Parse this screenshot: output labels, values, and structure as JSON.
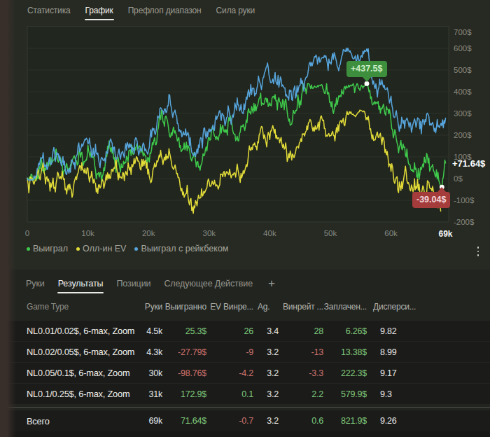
{
  "top_tabs": {
    "items": [
      {
        "label": "Статистика",
        "active": false
      },
      {
        "label": "График",
        "active": true
      },
      {
        "label": "Префлоп диапазон",
        "active": false
      },
      {
        "label": "Сила руки",
        "active": false
      }
    ]
  },
  "chart_data": {
    "type": "line",
    "title": "",
    "xlabel": "",
    "ylabel": "",
    "x_axis": {
      "ticks": [
        0,
        10,
        20,
        30,
        40,
        50,
        60,
        69
      ],
      "tick_labels": [
        "0",
        "10k",
        "20k",
        "30k",
        "40k",
        "50k",
        "60k",
        "69k"
      ],
      "range_k": [
        0,
        69.5
      ]
    },
    "y_axis": {
      "ticks": [
        700,
        600,
        500,
        400,
        300,
        200,
        100,
        0,
        -100,
        -200
      ],
      "tick_labels": [
        "700$",
        "600$",
        "500$",
        "400$",
        "300$",
        "200$",
        "100$",
        "0$",
        "-100$",
        "-200$"
      ],
      "range": [
        -200,
        700
      ]
    },
    "grid": true,
    "legend_position": "bottom-left",
    "series": [
      {
        "name": "Выиграл",
        "color": "#3fca4c",
        "seed": 11,
        "noise_amp": 68,
        "points": [
          [
            0,
            0
          ],
          [
            1,
            -5
          ],
          [
            2,
            45
          ],
          [
            3,
            40
          ],
          [
            4,
            70
          ],
          [
            5,
            90
          ],
          [
            6,
            45
          ],
          [
            7,
            30
          ],
          [
            8,
            80
          ],
          [
            9,
            135
          ],
          [
            10,
            140
          ],
          [
            11,
            85
          ],
          [
            12,
            30
          ],
          [
            13,
            85
          ],
          [
            14,
            125
          ],
          [
            15,
            95
          ],
          [
            16,
            70
          ],
          [
            17,
            120
          ],
          [
            18,
            155
          ],
          [
            19,
            125
          ],
          [
            20,
            100
          ],
          [
            21,
            185
          ],
          [
            22,
            285
          ],
          [
            23,
            265
          ],
          [
            24,
            225
          ],
          [
            25,
            175
          ],
          [
            26,
            145
          ],
          [
            27,
            95
          ],
          [
            28,
            70
          ],
          [
            29,
            130
          ],
          [
            30,
            180
          ],
          [
            31,
            200
          ],
          [
            32,
            215
          ],
          [
            33,
            215
          ],
          [
            34,
            210
          ],
          [
            35,
            215
          ],
          [
            36,
            255
          ],
          [
            37,
            325
          ],
          [
            38,
            340
          ],
          [
            39,
            350
          ],
          [
            40,
            350
          ],
          [
            41,
            350
          ],
          [
            42,
            335
          ],
          [
            43,
            285
          ],
          [
            44,
            300
          ],
          [
            45,
            355
          ],
          [
            46,
            390
          ],
          [
            47,
            420
          ],
          [
            48,
            425
          ],
          [
            49,
            395
          ],
          [
            50,
            345
          ],
          [
            51,
            360
          ],
          [
            52,
            400
          ],
          [
            53,
            430
          ],
          [
            54,
            400
          ],
          [
            55,
            420
          ],
          [
            56,
            437.5
          ],
          [
            57,
            340
          ],
          [
            58,
            330
          ],
          [
            59,
            300
          ],
          [
            60,
            265
          ],
          [
            61,
            165
          ],
          [
            62,
            150
          ],
          [
            63,
            70
          ],
          [
            64,
            55
          ],
          [
            65,
            30
          ],
          [
            66,
            95
          ],
          [
            67,
            40
          ],
          [
            68,
            -20
          ],
          [
            68.4,
            -39.04
          ],
          [
            69,
            71.64
          ]
        ],
        "clamp": [
          -39.04,
          437.5
        ]
      },
      {
        "name": "Олл-ин EV",
        "color": "#e2dc39",
        "seed": 7,
        "noise_amp": 72,
        "points": [
          [
            0,
            0
          ],
          [
            1,
            -10
          ],
          [
            2,
            5
          ],
          [
            3,
            -15
          ],
          [
            4,
            -42
          ],
          [
            5,
            22
          ],
          [
            6,
            -10
          ],
          [
            7,
            -29
          ],
          [
            8,
            20
          ],
          [
            9,
            64
          ],
          [
            10,
            55
          ],
          [
            11,
            0
          ],
          [
            12,
            -38
          ],
          [
            13,
            10
          ],
          [
            14,
            42
          ],
          [
            15,
            5
          ],
          [
            16,
            -19
          ],
          [
            17,
            40
          ],
          [
            18,
            93
          ],
          [
            19,
            50
          ],
          [
            20,
            32
          ],
          [
            21,
            70
          ],
          [
            22,
            115
          ],
          [
            23,
            80
          ],
          [
            24,
            51
          ],
          [
            25,
            0
          ],
          [
            26,
            -70
          ],
          [
            27,
            -100
          ],
          [
            28,
            -115
          ],
          [
            29,
            -60
          ],
          [
            30,
            -29
          ],
          [
            31,
            -10
          ],
          [
            32,
            5
          ],
          [
            33,
            26
          ],
          [
            34,
            15
          ],
          [
            35,
            10
          ],
          [
            36,
            60
          ],
          [
            37,
            131
          ],
          [
            38,
            160
          ],
          [
            39,
            180
          ],
          [
            40,
            185
          ],
          [
            41,
            198
          ],
          [
            42,
            160
          ],
          [
            43,
            89
          ],
          [
            44,
            110
          ],
          [
            45,
            160
          ],
          [
            46,
            211
          ],
          [
            47,
            240
          ],
          [
            48,
            265
          ],
          [
            49,
            246
          ],
          [
            50,
            204
          ],
          [
            51,
            230
          ],
          [
            52,
            272
          ],
          [
            53,
            300
          ],
          [
            54,
            290
          ],
          [
            55,
            313
          ],
          [
            56,
            288
          ],
          [
            57,
            192
          ],
          [
            58,
            179
          ],
          [
            59,
            125
          ],
          [
            60,
            42
          ],
          [
            61,
            0
          ],
          [
            62,
            -20
          ],
          [
            63,
            -26
          ],
          [
            64,
            -38
          ],
          [
            65,
            -67
          ],
          [
            66,
            -13
          ],
          [
            67,
            -54
          ],
          [
            68,
            -110
          ],
          [
            68.2,
            -150
          ]
        ],
        "clamp": [
          -160,
          320
        ]
      },
      {
        "name": "Выиграл с рейкбеком",
        "color": "#57a5dc",
        "seed": 23,
        "noise_amp": 68,
        "points": [
          [
            0,
            0
          ],
          [
            1,
            0
          ],
          [
            2,
            50
          ],
          [
            3,
            50
          ],
          [
            4,
            80
          ],
          [
            5,
            105
          ],
          [
            6,
            60
          ],
          [
            7,
            45
          ],
          [
            8,
            95
          ],
          [
            9,
            150
          ],
          [
            10,
            160
          ],
          [
            11,
            105
          ],
          [
            12,
            55
          ],
          [
            13,
            110
          ],
          [
            14,
            150
          ],
          [
            15,
            120
          ],
          [
            16,
            95
          ],
          [
            17,
            145
          ],
          [
            18,
            180
          ],
          [
            19,
            155
          ],
          [
            20,
            135
          ],
          [
            21,
            220
          ],
          [
            22,
            330
          ],
          [
            23,
            310
          ],
          [
            24,
            285
          ],
          [
            25,
            230
          ],
          [
            26,
            195
          ],
          [
            27,
            150
          ],
          [
            28,
            145
          ],
          [
            29,
            195
          ],
          [
            30,
            225
          ],
          [
            31,
            265
          ],
          [
            32,
            280
          ],
          [
            33,
            300
          ],
          [
            34,
            295
          ],
          [
            35,
            310
          ],
          [
            36,
            355
          ],
          [
            37,
            400
          ],
          [
            38,
            440
          ],
          [
            39,
            455
          ],
          [
            40,
            457
          ],
          [
            41,
            455
          ],
          [
            42,
            430
          ],
          [
            43,
            390
          ],
          [
            44,
            400
          ],
          [
            45,
            440
          ],
          [
            46,
            465
          ],
          [
            47,
            520
          ],
          [
            48,
            555
          ],
          [
            49,
            570
          ],
          [
            50,
            525
          ],
          [
            51,
            540
          ],
          [
            52,
            560
          ],
          [
            53,
            590
          ],
          [
            54,
            565
          ],
          [
            55,
            560
          ],
          [
            56,
            597
          ],
          [
            57,
            450
          ],
          [
            58,
            435
          ],
          [
            59,
            420
          ],
          [
            60,
            380
          ],
          [
            61,
            272
          ],
          [
            62,
            250
          ],
          [
            63,
            246
          ],
          [
            64,
            259
          ],
          [
            65,
            220
          ],
          [
            66,
            300
          ],
          [
            67,
            250
          ],
          [
            68,
            230
          ],
          [
            69,
            278
          ]
        ],
        "clamp": [
          -10,
          605
        ]
      }
    ],
    "markers": {
      "max": {
        "label": "+437.5$",
        "k": 56,
        "value": 437.5,
        "badge_color": "#3d8f3d",
        "text_color": "#cfeec7"
      },
      "min": {
        "label": "-39.04$",
        "k": 68.4,
        "value": -39.04,
        "badge_color": "#a53c3c",
        "text_color": "#f2d9d9"
      },
      "current": {
        "label": "+71.64$",
        "value": 71.64
      }
    },
    "legend": [
      {
        "label": "Выиграл",
        "color": "#3fca4c"
      },
      {
        "label": "Олл-ин EV",
        "color": "#e2dc39"
      },
      {
        "label": "Выиграл с рейкбеком",
        "color": "#57a5dc"
      }
    ],
    "colors": {
      "grid": "#2d332a",
      "plot_border": "#343a31",
      "axis_text": "#87877f",
      "marker_dot": "#ffffff"
    }
  },
  "results_tabs": {
    "items": [
      {
        "label": "Руки",
        "active": false
      },
      {
        "label": "Результаты",
        "active": true
      },
      {
        "label": "Позиции",
        "active": false
      },
      {
        "label": "Следующее Действие",
        "active": false
      }
    ],
    "add_label": "+"
  },
  "table": {
    "columns": [
      {
        "label": "Game Type",
        "colorize": "none"
      },
      {
        "label": "Руки",
        "colorize": "none"
      },
      {
        "label": "Выигранно",
        "colorize": "posneg"
      },
      {
        "label": "EV Винре...",
        "colorize": "posneg"
      },
      {
        "label": "Ag.",
        "colorize": "none"
      },
      {
        "label": "Винрейт ...",
        "colorize": "posneg"
      },
      {
        "label": "Заплачен...",
        "colorize": "green"
      },
      {
        "label": "Дисперси...",
        "colorize": "none"
      }
    ],
    "rows": [
      [
        "NL0.01/0.02$, 6-max, Zoom",
        "4.5k",
        "25.3$",
        "26",
        "3.4",
        "28",
        "6.26$",
        "9.82"
      ],
      [
        "NL0.02/0.05$, 6-max, Zoom",
        "4.3k",
        "-27.79$",
        "-9",
        "3.2",
        "-13",
        "13.38$",
        "8.99"
      ],
      [
        "NL0.05/0.1$, 6-max, Zoom",
        "30k",
        "-98.76$",
        "-4.2",
        "3.2",
        "-3.3",
        "222.3$",
        "9.17"
      ],
      [
        "NL0.1/0.25$, 6-max, Zoom",
        "31k",
        "172.9$",
        "0.1",
        "3.2",
        "2.2",
        "579.9$",
        "9.3"
      ]
    ],
    "total": [
      "Всего",
      "69k",
      "71.64$",
      "-0.7",
      "3.2",
      "0.6",
      "821.9$",
      "9.26"
    ]
  }
}
